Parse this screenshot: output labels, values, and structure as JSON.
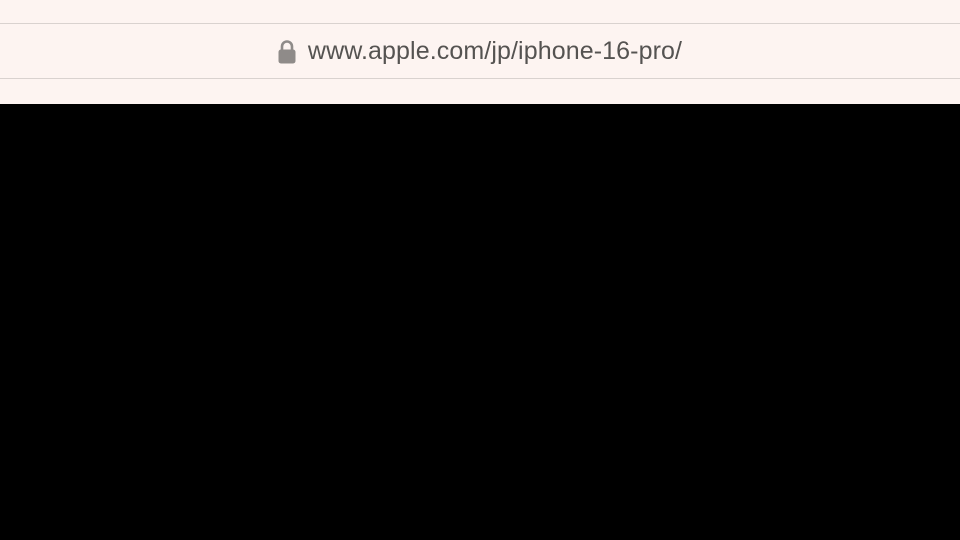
{
  "address_bar": {
    "url": "www.apple.com/jp/iphone-16-pro/",
    "lock_icon": "lock-icon",
    "text_color": "#555351",
    "background": "#fdf4f1"
  },
  "page": {
    "background": "#000000"
  }
}
